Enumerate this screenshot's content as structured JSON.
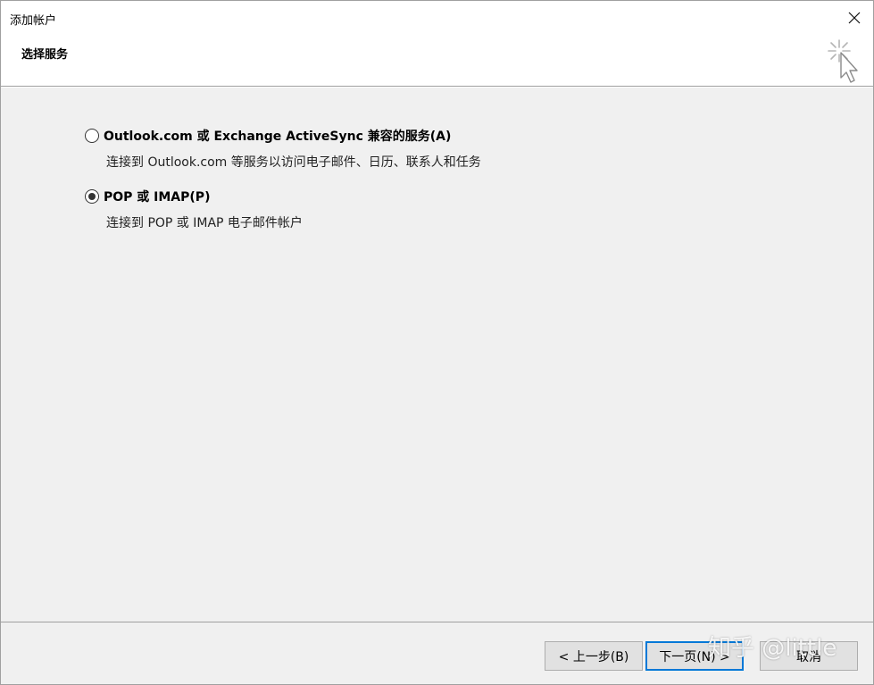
{
  "window": {
    "title": "添加帐户",
    "close_icon": "close-icon"
  },
  "header": {
    "title": "选择服务",
    "icon": "wizard-cursor-icon"
  },
  "options": [
    {
      "label": "Outlook.com 或 Exchange ActiveSync 兼容的服务(A)",
      "description": "连接到 Outlook.com 等服务以访问电子邮件、日历、联系人和任务",
      "selected": false
    },
    {
      "label": "POP 或 IMAP(P)",
      "description": "连接到 POP 或 IMAP 电子邮件帐户",
      "selected": true
    }
  ],
  "footer": {
    "back_label": "< 上一步(B)",
    "next_label": "下一页(N) >",
    "cancel_label": "取消"
  },
  "watermark": {
    "text": "知乎 @little"
  },
  "colors": {
    "content_bg": "#f0f0f0",
    "accent": "#0078d7"
  }
}
